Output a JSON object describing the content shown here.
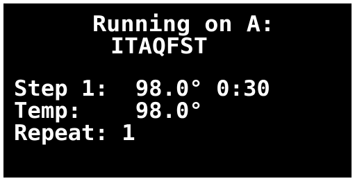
{
  "display": {
    "status_line": "Running on A:",
    "run_name": "ITAQFST",
    "step": {
      "label": "Step 1:",
      "temperature": "98.0°",
      "time": "0:30"
    },
    "temp": {
      "label": "Temp:",
      "value": "98.0°"
    },
    "repeat": {
      "label": "Repeat:",
      "value": "1"
    }
  },
  "colors": {
    "screen_background": "#000000",
    "text": "#ffffff"
  }
}
